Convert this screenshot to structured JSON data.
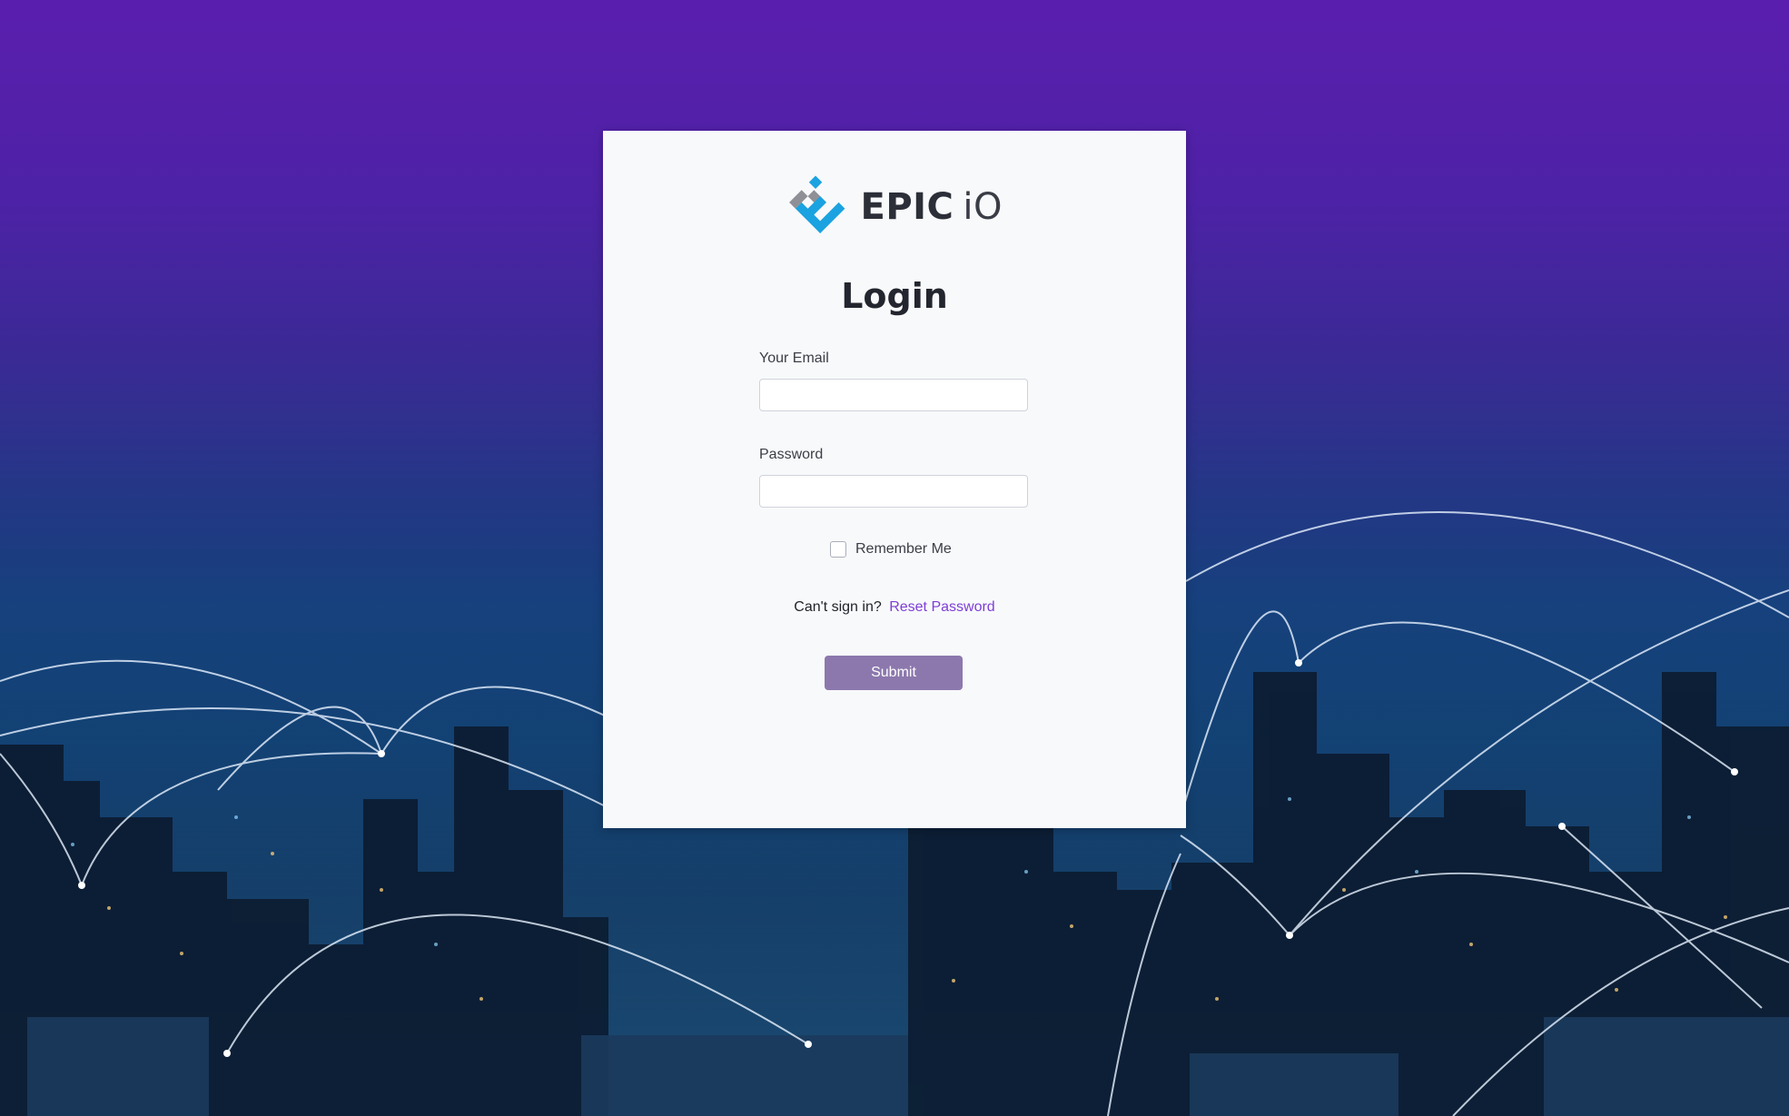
{
  "brand": {
    "name_bold": "EPIC",
    "name_light": "iO",
    "colors": {
      "mark_blue": "#1aa3e0",
      "mark_gray": "#8e9096",
      "text": "#2c2f38"
    }
  },
  "form": {
    "title": "Login",
    "email_label": "Your Email",
    "email_value": "",
    "password_label": "Password",
    "password_value": "",
    "remember_label": "Remember Me",
    "remember_checked": false,
    "cant_sign_in_text": "Can't sign in?",
    "reset_link_label": "Reset Password",
    "submit_label": "Submit"
  },
  "colors": {
    "accent_link": "#7e3fd6",
    "submit_bg": "#8c78ad",
    "card_bg": "#f8f9fb",
    "bg_top": "#5a1eae",
    "bg_bottom": "#0a1e38"
  },
  "icons": {
    "logo": "epic-io-logo-icon"
  }
}
